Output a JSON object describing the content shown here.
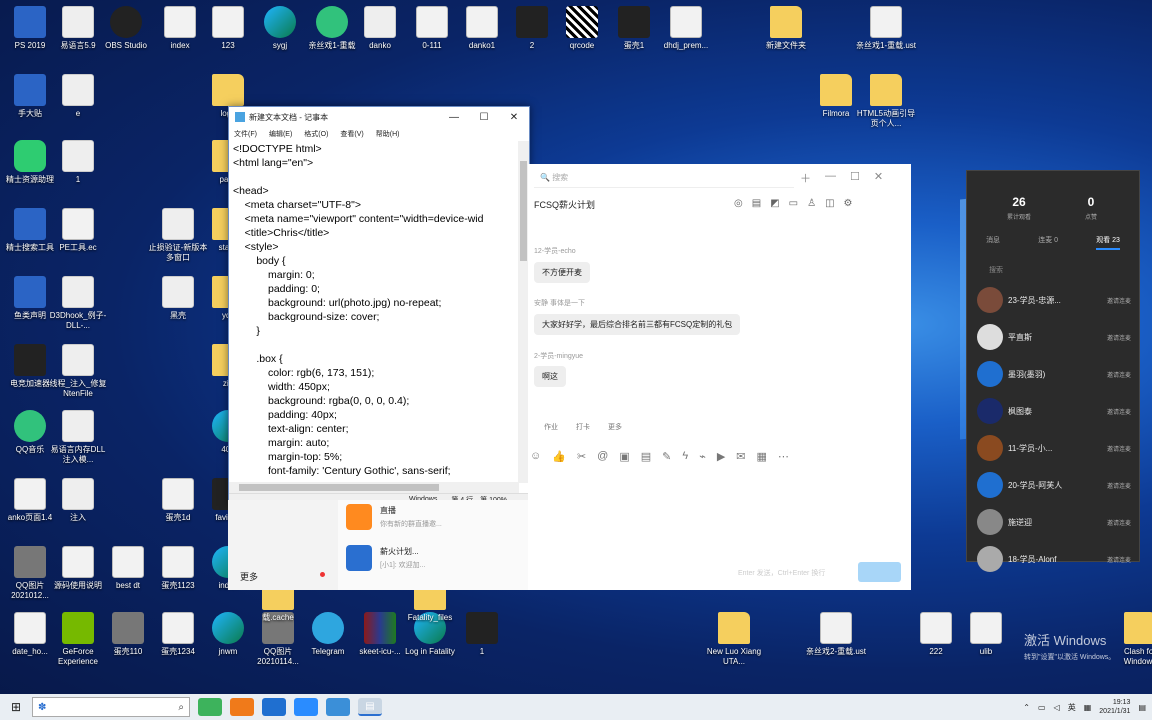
{
  "desktop_icons": [
    {
      "label": "PS 2019",
      "icon": "word-icon",
      "style": "word"
    },
    {
      "label": "易语言5.9",
      "icon": "app-icon",
      "style": "app"
    },
    {
      "label": "OBS Studio",
      "icon": "obs-icon",
      "style": "obs"
    },
    {
      "label": "index",
      "icon": "doc-icon",
      "style": "doc"
    },
    {
      "label": "123",
      "icon": "doc-icon",
      "style": "doc"
    },
    {
      "label": "sygj",
      "icon": "edge-icon",
      "style": "edge"
    },
    {
      "label": "亲丝戏1-重载",
      "icon": "music-icon",
      "style": "music"
    },
    {
      "label": "danko",
      "icon": "app-icon",
      "style": "app"
    },
    {
      "label": "0-111",
      "icon": "app-icon",
      "style": "doc"
    },
    {
      "label": "danko1",
      "icon": "app-icon",
      "style": "doc"
    },
    {
      "label": "2",
      "icon": "app-icon",
      "style": "dark"
    },
    {
      "label": "qrcode",
      "icon": "qr-icon",
      "style": "qr"
    },
    {
      "label": "蛋壳1",
      "icon": "app-icon",
      "style": "dark"
    },
    {
      "label": "dhdj_prem...",
      "icon": "doc-icon",
      "style": "doc"
    },
    {
      "label": "新建文件夹",
      "icon": "folder-icon",
      "style": "folder"
    },
    {
      "label": "亲丝戏1-重载.ust",
      "icon": "doc-icon",
      "style": "doc"
    },
    {
      "label": "手大贴",
      "icon": "app-icon",
      "style": "word"
    },
    {
      "label": "e",
      "icon": "app-icon",
      "style": "app"
    },
    {
      "label": "logo",
      "icon": "folder-icon",
      "style": "folder"
    },
    {
      "label": "Filmora",
      "icon": "folder-icon",
      "style": "folder"
    },
    {
      "label": "HTML5动画引导页个人...",
      "icon": "folder-icon",
      "style": "folder"
    },
    {
      "label": "精士资源助理",
      "icon": "app-icon",
      "style": "green"
    },
    {
      "label": "1",
      "icon": "app-icon",
      "style": "app"
    },
    {
      "label": "pass",
      "icon": "folder-icon",
      "style": "folder"
    },
    {
      "label": "精士搜索工具",
      "icon": "app-icon",
      "style": "word"
    },
    {
      "label": "PE工具.ec",
      "icon": "doc-icon",
      "style": "doc"
    },
    {
      "label": "止损验证-新版本多窗口",
      "icon": "app-icon",
      "style": "app"
    },
    {
      "label": "static",
      "icon": "folder-icon",
      "style": "folder"
    },
    {
      "label": "鱼类声明",
      "icon": "word-icon",
      "style": "word"
    },
    {
      "label": "D3Dhook_例子-DLL-...",
      "icon": "app-icon",
      "style": "app"
    },
    {
      "label": "黑壳",
      "icon": "app-icon",
      "style": "app"
    },
    {
      "label": "yqjj",
      "icon": "folder-icon",
      "style": "folder"
    },
    {
      "label": "电竞加速器",
      "icon": "app-icon",
      "style": "dark"
    },
    {
      "label": "线程_注入_修复NtenFile",
      "icon": "app-icon",
      "style": "app"
    },
    {
      "label": "zip",
      "icon": "folder-icon",
      "style": "folder"
    },
    {
      "label": "QQ音乐",
      "icon": "music-icon",
      "style": "music"
    },
    {
      "label": "易语言内存DLL注入模...",
      "icon": "app-icon",
      "style": "app"
    },
    {
      "label": "404",
      "icon": "edge-icon",
      "style": "edge"
    },
    {
      "label": "anko页面1.4",
      "icon": "doc-icon",
      "style": "doc"
    },
    {
      "label": "注入",
      "icon": "app-icon",
      "style": "app"
    },
    {
      "label": "蛋壳1d",
      "icon": "doc-icon",
      "style": "doc"
    },
    {
      "label": "favicon",
      "icon": "app-icon",
      "style": "dark"
    },
    {
      "label": "QQ图片2021012...",
      "icon": "app-icon",
      "style": "gray"
    },
    {
      "label": "源码使用说明",
      "icon": "doc-icon",
      "style": "doc"
    },
    {
      "label": "best dt",
      "icon": "app-icon",
      "style": "doc"
    },
    {
      "label": "蛋壳1123",
      "icon": "doc-icon",
      "style": "doc"
    },
    {
      "label": "index",
      "icon": "edge-icon",
      "style": "edge"
    },
    {
      "label": "date_ho...",
      "icon": "doc-icon",
      "style": "doc"
    },
    {
      "label": "GeForce Experience",
      "icon": "nvidia-icon",
      "style": "nvidia"
    },
    {
      "label": "蛋壳110",
      "icon": "app-icon",
      "style": "gray"
    },
    {
      "label": "蛋壳1234",
      "icon": "doc-icon",
      "style": "doc"
    },
    {
      "label": "jnwm",
      "icon": "edge-icon",
      "style": "edge"
    },
    {
      "label": "QQ图片20210114...",
      "icon": "app-icon",
      "style": "gray"
    },
    {
      "label": "Telegram",
      "icon": "telegram-icon",
      "style": "tele"
    },
    {
      "label": "skeet-icu-...",
      "icon": "rar-icon",
      "style": "rar"
    },
    {
      "label": "Log in Fatality",
      "icon": "edge-icon",
      "style": "edge"
    },
    {
      "label": "1",
      "icon": "app-icon",
      "style": "dark"
    },
    {
      "label": "New Luo Xiang UTA...",
      "icon": "folder-icon",
      "style": "folder"
    },
    {
      "label": "亲丝戏2-重载.ust",
      "icon": "doc-icon",
      "style": "doc"
    },
    {
      "label": "222",
      "icon": "app-icon",
      "style": "doc"
    },
    {
      "label": "ulib",
      "icon": "app-icon",
      "style": "doc"
    },
    {
      "label": "Clash for Windows",
      "icon": "folder-icon",
      "style": "folder"
    },
    {
      "label": "载.cache",
      "icon": "folder-icon",
      "style": "folder"
    },
    {
      "label": "Fatality_files",
      "icon": "folder-icon",
      "style": "folder"
    }
  ],
  "notepad": {
    "title": "新建文本文档 - 记事本",
    "menu": [
      "文件(F)",
      "编辑(E)",
      "格式(O)",
      "查看(V)",
      "帮助(H)"
    ],
    "lines": [
      "<!DOCTYPE html>",
      "<html lang=\"en\">",
      "",
      "<head>",
      "    <meta charset=\"UTF-8\">",
      "    <meta name=\"viewport\" content=\"width=device-wid",
      "    <title>Chris</title>",
      "    <style>",
      "        body {",
      "            margin: 0;",
      "            padding: 0;",
      "            background: url(photo.jpg) no-repeat;",
      "            background-size: cover;",
      "        }",
      "",
      "        .box {",
      "            color: rgb(6, 173, 151);",
      "            width: 450px;",
      "            background: rgba(0, 0, 0, 0.4);",
      "            padding: 40px;",
      "            text-align: center;",
      "            margin: auto;",
      "            margin-top: 5%;",
      "            font-family: 'Century Gothic', sans-serif;"
    ],
    "status_encoding": "Windows",
    "status_position": "第 4 行，第 100%"
  },
  "qq": {
    "search_placeholder": "搜索",
    "chat_title": "FCSQ薪火计划",
    "messages": [
      {
        "name": "12-学员-echo",
        "text": "不方便开麦"
      },
      {
        "name": "安静   事体是一下",
        "text": "大家好好学，最后综合排名前三都有FCSQ定制的礼包"
      },
      {
        "name": "2-学员-mingyue",
        "text": "啊这"
      }
    ],
    "input_tabs": [
      "作业",
      "打卡",
      "更多"
    ],
    "send_hint": "Enter 发送，Ctrl+Enter 换行",
    "more_label": "更多",
    "list": [
      {
        "title": "直播",
        "sub": "你有新的群直播邀..."
      },
      {
        "title": "薪火计划...",
        "sub": "[小1]: 欢迎加..."
      }
    ]
  },
  "panel": {
    "stat_left_value": "26",
    "stat_left_label": "累计观看",
    "stat_right_value": "0",
    "stat_right_label": "点赞",
    "tabs": [
      "消息",
      "连麦 0",
      "观看 23"
    ],
    "search_placeholder": "搜索",
    "members": [
      {
        "name": "23-学员-忠源...",
        "action": "邀请连麦"
      },
      {
        "name": "平直斯",
        "action": "邀请连麦"
      },
      {
        "name": "墨羽(墨羽)",
        "action": "邀请连麦"
      },
      {
        "name": "枫图泰",
        "action": "邀请连麦"
      },
      {
        "name": "11-学员-小...",
        "action": "邀请连麦"
      },
      {
        "name": "20-学员-阿芙人",
        "action": "邀请连麦"
      },
      {
        "name": "施逆迎",
        "action": "邀请连麦"
      },
      {
        "name": "18-学员-Alonf",
        "action": "邀请连麦"
      }
    ]
  },
  "activation": {
    "line1": "激活 Windows",
    "line2": "转到\"设置\"以激活 Windows。"
  },
  "taskbar": {
    "search_value": "",
    "clock_time": "19:13",
    "clock_date": "2021/1/31",
    "ime": "英"
  }
}
